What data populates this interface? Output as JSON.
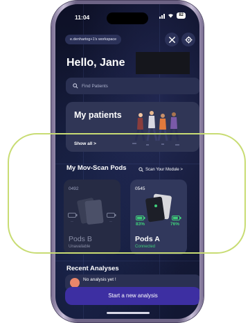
{
  "status": {
    "time": "11:04",
    "battery": "82"
  },
  "header": {
    "workspace": "e.denhartog+1's workspace"
  },
  "greeting": "Hello, Jane",
  "search": {
    "placeholder": "Find Patients"
  },
  "patients_card": {
    "title": "My patients",
    "show_all": "Show all >"
  },
  "pods_section": {
    "title": "My Mov-Scan Pods",
    "scan_link": "Scan Your Module >",
    "pods": [
      {
        "id": "0492",
        "name": "Pods B",
        "status": "Unavailable",
        "left_value": "--",
        "right_value": "--",
        "status_color": "#8b90a8"
      },
      {
        "id": "0545",
        "name": "Pods A",
        "status": "Connected",
        "left_value": "83%",
        "right_value": "76%",
        "status_color": "#3fcf7a"
      }
    ]
  },
  "recent": {
    "title": "Recent Analyses",
    "empty_text": "No analysis yet !"
  },
  "cta": {
    "label": "Start a new analysis"
  },
  "colors": {
    "highlight": "#c8dc73",
    "accent": "#3d2fa2",
    "connected": "#3fcf7a"
  }
}
